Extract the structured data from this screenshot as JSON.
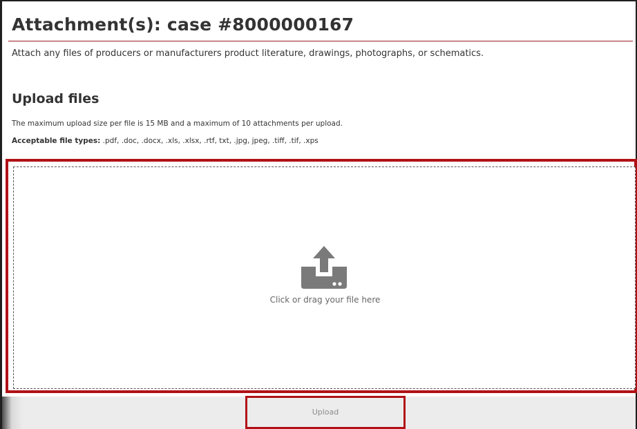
{
  "page": {
    "title": "Attachment(s): case #8000000167",
    "intro": "Attach any files of producers or manufacturers product literature, drawings, photographs, or schematics."
  },
  "upload": {
    "heading": "Upload files",
    "limits_text": "The maximum upload size per file is 15 MB and a maximum of 10 attachments per upload.",
    "filetypes_label": "Acceptable file types:",
    "filetypes_value": " .pdf, .doc, .docx, .xls, .xlsx, .rtf, txt, .jpg, jpeg, .tiff, .tif, .xps",
    "dropzone_text": "Click or drag your file here",
    "dropzone_icon": "upload-tray-icon",
    "button_label": "Upload"
  },
  "colors": {
    "highlight": "#b01117",
    "title_rule": "#9b1b1f",
    "icon": "#7a7a7a"
  }
}
